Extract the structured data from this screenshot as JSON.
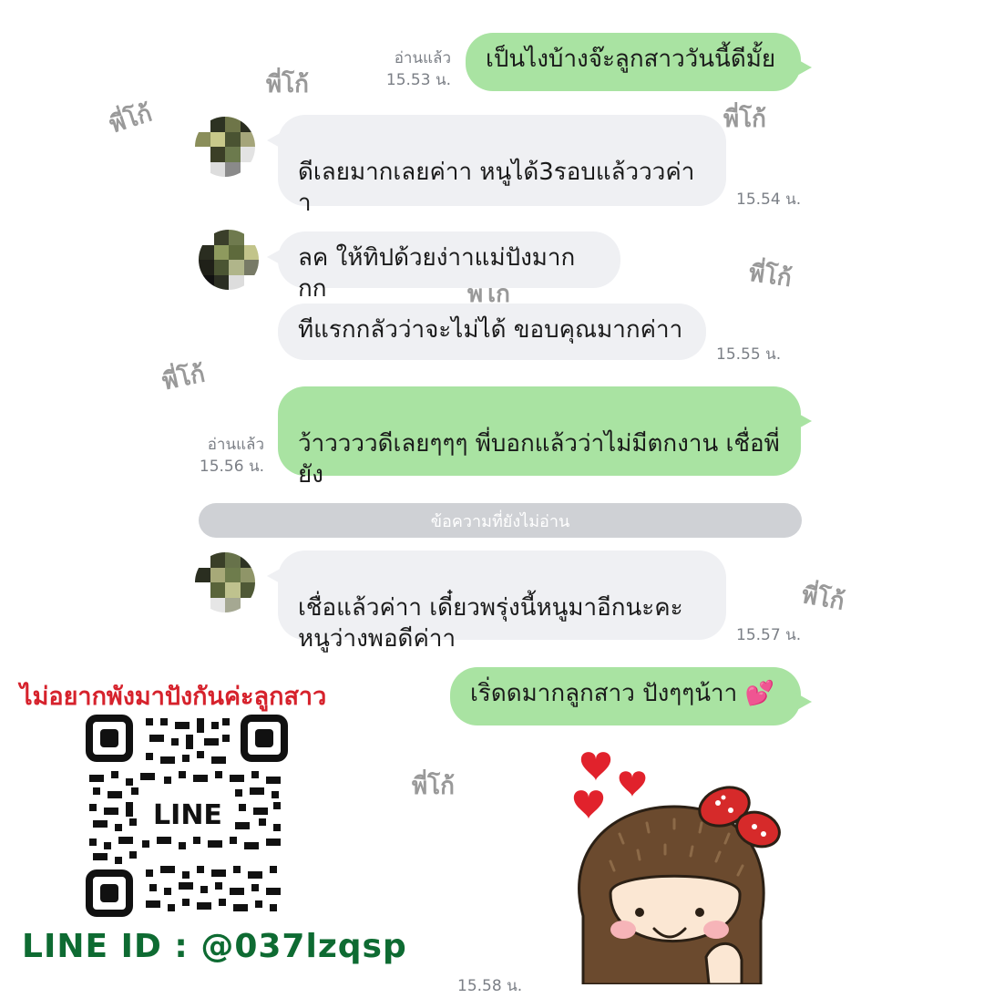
{
  "watermark": "พี่โก้",
  "messages": [
    {
      "text": "เป็นไงบ้างจ๊ะลูกสาววันนี้ดีมั้ย",
      "read": "อ่านแล้ว",
      "time": "15.53 น."
    },
    {
      "text": "ดีเลยมากเลยค่าา หนูได้3รอบแล้วววค่า\nา",
      "time": "15.54 น."
    },
    {
      "text": "ลค ให้ทิปด้วยง่าาแม่ปังมากกก"
    },
    {
      "text": "ทีแรกกลัวว่าจะไม่ได้ ขอบคุณมากค่าา",
      "time": "15.55 น."
    },
    {
      "text": "ว้าววววดีเลยๆๆๆ พี่บอกแล้วว่าไม่มีตกงาน เชื่อพี่\nยัง",
      "read": "อ่านแล้ว",
      "time": "15.56 น."
    },
    {
      "text": "เชื่อแล้วค่าา เดี๋ยวพรุ่งนี้หนูมาอีกนะคะ\nหนูว่างพอดีค่าา",
      "time": "15.57 น."
    },
    {
      "text": "เริ่ดดมากลูกสาว ปังๆๆน้าา",
      "emoji": "💕",
      "time": "15.58 น."
    }
  ],
  "unread_divider": "ข้อความที่ยังไม่อ่าน",
  "promo": {
    "title": "ไม่อยากพังมาปังกันค่ะลูกสาว",
    "qr_label": "LINE",
    "line_id": "LINE ID : @037lzqsp"
  },
  "colors": {
    "outgoing_bubble": "#a9e3a2",
    "incoming_bubble": "#eff0f3",
    "promo_title": "#d6222c",
    "line_id": "#0e6b32"
  },
  "icons": [
    "avatar-pixelated",
    "qr-code",
    "sticker-girl-with-hearts"
  ]
}
